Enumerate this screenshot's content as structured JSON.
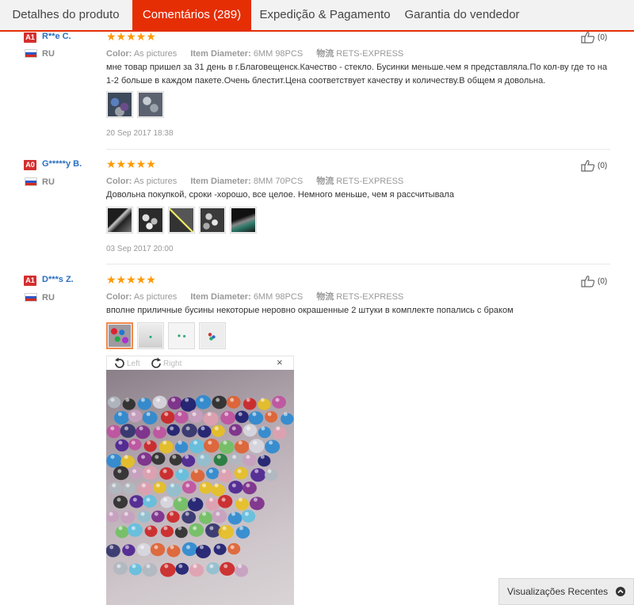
{
  "tabs": [
    {
      "label": "Detalhes do produto"
    },
    {
      "label": "Comentários (289)"
    },
    {
      "label": "Expedição & Pagamento"
    },
    {
      "label": "Garantia do vendedor"
    }
  ],
  "active_tab": 1,
  "stars": "★★★★★",
  "reviews": [
    {
      "level": "A1",
      "user": "R**e C.",
      "country": "RU",
      "color_label": "Color:",
      "color_value": "As pictures",
      "item_label": "Item Diameter:",
      "item_value": "6MM 98PCS",
      "ship_label": "物流",
      "ship_value": "RETS-EXPRESS",
      "text": "мне товар пришел за 31 день в г.Благовещенск.Качество - стекло. Бусинки меньше.чем я представляла.По кол-ву где то на 1-2 больше в каждом пакете.Очень блестит.Цена соответствует качеству и количеству.В общем я довольна.",
      "date": "20 Sep 2017 18:38",
      "helpful": "(0)"
    },
    {
      "level": "A0",
      "user": "G*****y B.",
      "country": "RU",
      "color_label": "Color:",
      "color_value": "As pictures",
      "item_label": "Item Diameter:",
      "item_value": "8MM 70PCS",
      "ship_label": "物流",
      "ship_value": "RETS-EXPRESS",
      "text": "Довольна покупкой, сроки -хорошо, все целое. Немного меньше, чем я рассчитывала",
      "date": "03 Sep 2017 20:00",
      "helpful": "(0)"
    },
    {
      "level": "A1",
      "user": "D***s Z.",
      "country": "RU",
      "color_label": "Color:",
      "color_value": "As pictures",
      "item_label": "Item Diameter:",
      "item_value": "6MM 98PCS",
      "ship_label": "物流",
      "ship_value": "RETS-EXPRESS",
      "text": "вполне приличные бусины некоторые неровно окрашенные 2 штуки в комплекте попались с браком",
      "helpful": "(0)"
    }
  ],
  "viewer": {
    "rotate_left": "Left",
    "rotate_right": "Right",
    "close": "×"
  },
  "recent": {
    "label": "Visualizações Recentes"
  },
  "colors": {
    "accent": "#e62e04",
    "star": "#ff9900",
    "link": "#2a6fbf"
  }
}
